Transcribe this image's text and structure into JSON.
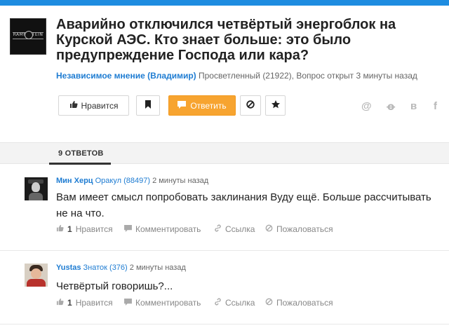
{
  "question": {
    "avatar_text": "RAMM STEIN",
    "title": "Аварийно отключился четвёртый энергоблок на Курской АЭС. Кто знает больше: это было предупреждение Господа или кара?",
    "author": "Независимое мнение (Владимир)",
    "author_rank": "Просветленный (21922), Вопрос открыт 3 минуты назад"
  },
  "buttons": {
    "like_label": "Нравится",
    "answer_label": "Ответить",
    "like_icon": "thumbs-up-icon",
    "bookmark_icon": "bookmark-icon",
    "answer_icon": "comment-icon",
    "block_icon": "block-icon",
    "star_icon": "star-icon"
  },
  "social": {
    "mail": "@",
    "ok": "ꝋ",
    "vk": "в",
    "fb": "f"
  },
  "answers_tab": "9 ОТВЕТОВ",
  "answers": [
    {
      "name": "Мин Херц",
      "rank": "Оракул (88497)",
      "time": "2 минуты назад",
      "text": "Вам имеет смысл попробовать заклинания Вуду ещё. Больше рассчитывать не на что.",
      "likes": "1",
      "like_label": "Нравится",
      "comment_label": "Комментировать",
      "link_label": "Ссылка",
      "report_label": "Пожаловаться"
    },
    {
      "name": "Yustas",
      "rank": "Знаток (376)",
      "time": "2 минуты назад",
      "text": "Четвёртый говоришь?...",
      "likes": "1",
      "like_label": "Нравится",
      "comment_label": "Комментировать",
      "link_label": "Ссылка",
      "report_label": "Пожаловаться"
    }
  ],
  "colors": {
    "accent": "#1e8ce0",
    "answer_button": "#f7a430",
    "link": "#1e7cd2"
  }
}
